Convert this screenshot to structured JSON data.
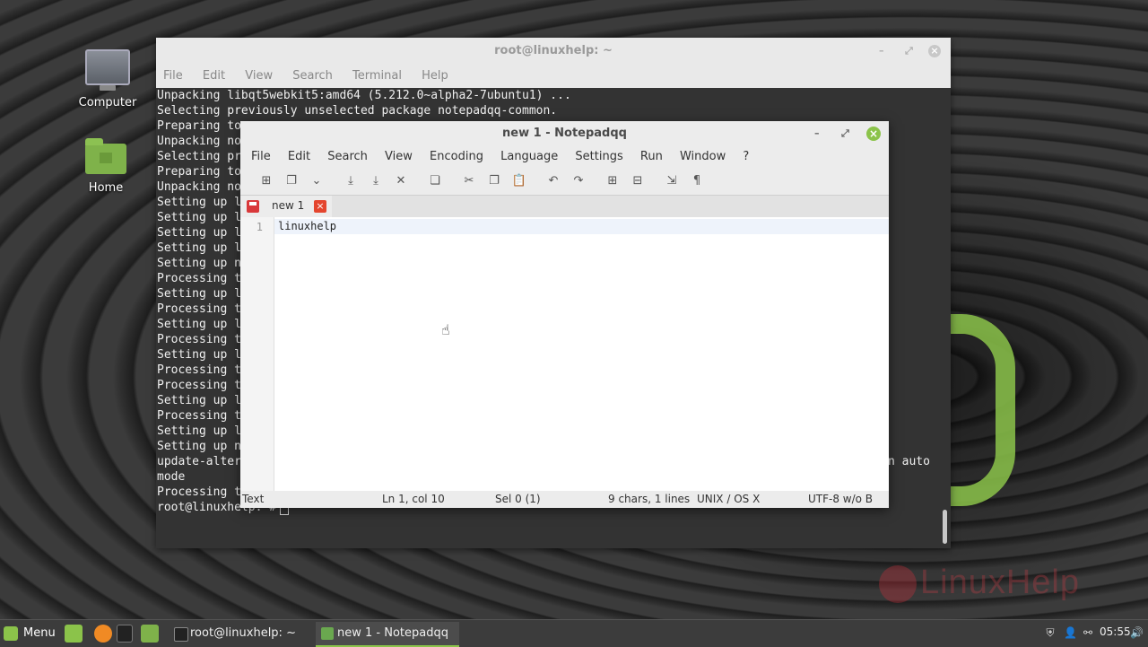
{
  "desktop": {
    "icons": [
      {
        "label": "Computer"
      },
      {
        "label": "Home"
      }
    ],
    "watermark": "LinuxHelp"
  },
  "terminal": {
    "title": "root@linuxhelp: ~",
    "menu": [
      "File",
      "Edit",
      "View",
      "Search",
      "Terminal",
      "Help"
    ],
    "lines": [
      "Unpacking libqt5webkit5:amd64 (5.212.0~alpha2-7ubuntu1) ...",
      "Selecting previously unselected package notepadqq-common.",
      "Preparing to",
      "Unpacking no",
      "Selecting pr",
      "Preparing to",
      "Unpacking no",
      "Setting up l",
      "Setting up l",
      "Setting up l",
      "Setting up l",
      "Setting up n",
      "Processing t",
      "Setting up l",
      "Processing t",
      "Setting up l",
      "Processing t",
      "Setting up l",
      "Processing t",
      "Processing t",
      "Setting up l",
      "Processing t",
      "Setting up l",
      "Setting up n",
      "update-alter",
      "mode",
      "Processing t"
    ],
    "right_fragment": "n auto",
    "prompt": "root@linuxhelp:~#"
  },
  "notepad": {
    "title": "new 1 - Notepadqq",
    "menu": [
      "File",
      "Edit",
      "Search",
      "View",
      "Encoding",
      "Language",
      "Settings",
      "Run",
      "Window",
      "?"
    ],
    "toolbar": [
      {
        "name": "new-file-icon",
        "glyph": "⊞"
      },
      {
        "name": "open-file-icon",
        "glyph": "❐"
      },
      {
        "name": "open-dropdown-icon",
        "glyph": "⌄"
      },
      {
        "name": "save-icon",
        "glyph": "⤓"
      },
      {
        "name": "save-all-icon",
        "glyph": "⤓"
      },
      {
        "name": "close-file-icon",
        "glyph": "✕"
      },
      {
        "name": "close-all-icon",
        "glyph": "❏"
      },
      {
        "name": "cut-icon",
        "glyph": "✂"
      },
      {
        "name": "copy-icon",
        "glyph": "❐"
      },
      {
        "name": "paste-icon",
        "glyph": "📋"
      },
      {
        "name": "undo-icon",
        "glyph": "↶"
      },
      {
        "name": "redo-icon",
        "glyph": "↷"
      },
      {
        "name": "zoom-in-icon",
        "glyph": "⊞"
      },
      {
        "name": "zoom-out-icon",
        "glyph": "⊟"
      },
      {
        "name": "word-wrap-icon",
        "glyph": "⇲"
      },
      {
        "name": "show-symbols-icon",
        "glyph": "¶"
      }
    ],
    "tab_label": "new 1",
    "line_number": "1",
    "content": "linuxhelp",
    "status": {
      "language": "Text",
      "position": "Ln 1, col 10",
      "selection": "Sel 0 (1)",
      "counts": "9 chars, 1 lines",
      "eol": "UNIX / OS X",
      "encoding": "UTF-8 w/o B"
    }
  },
  "taskbar": {
    "menu_label": "Menu",
    "tasks": [
      {
        "label": "root@linuxhelp: ~"
      },
      {
        "label": "new 1 - Notepadqq"
      }
    ],
    "clock": "05:55"
  }
}
